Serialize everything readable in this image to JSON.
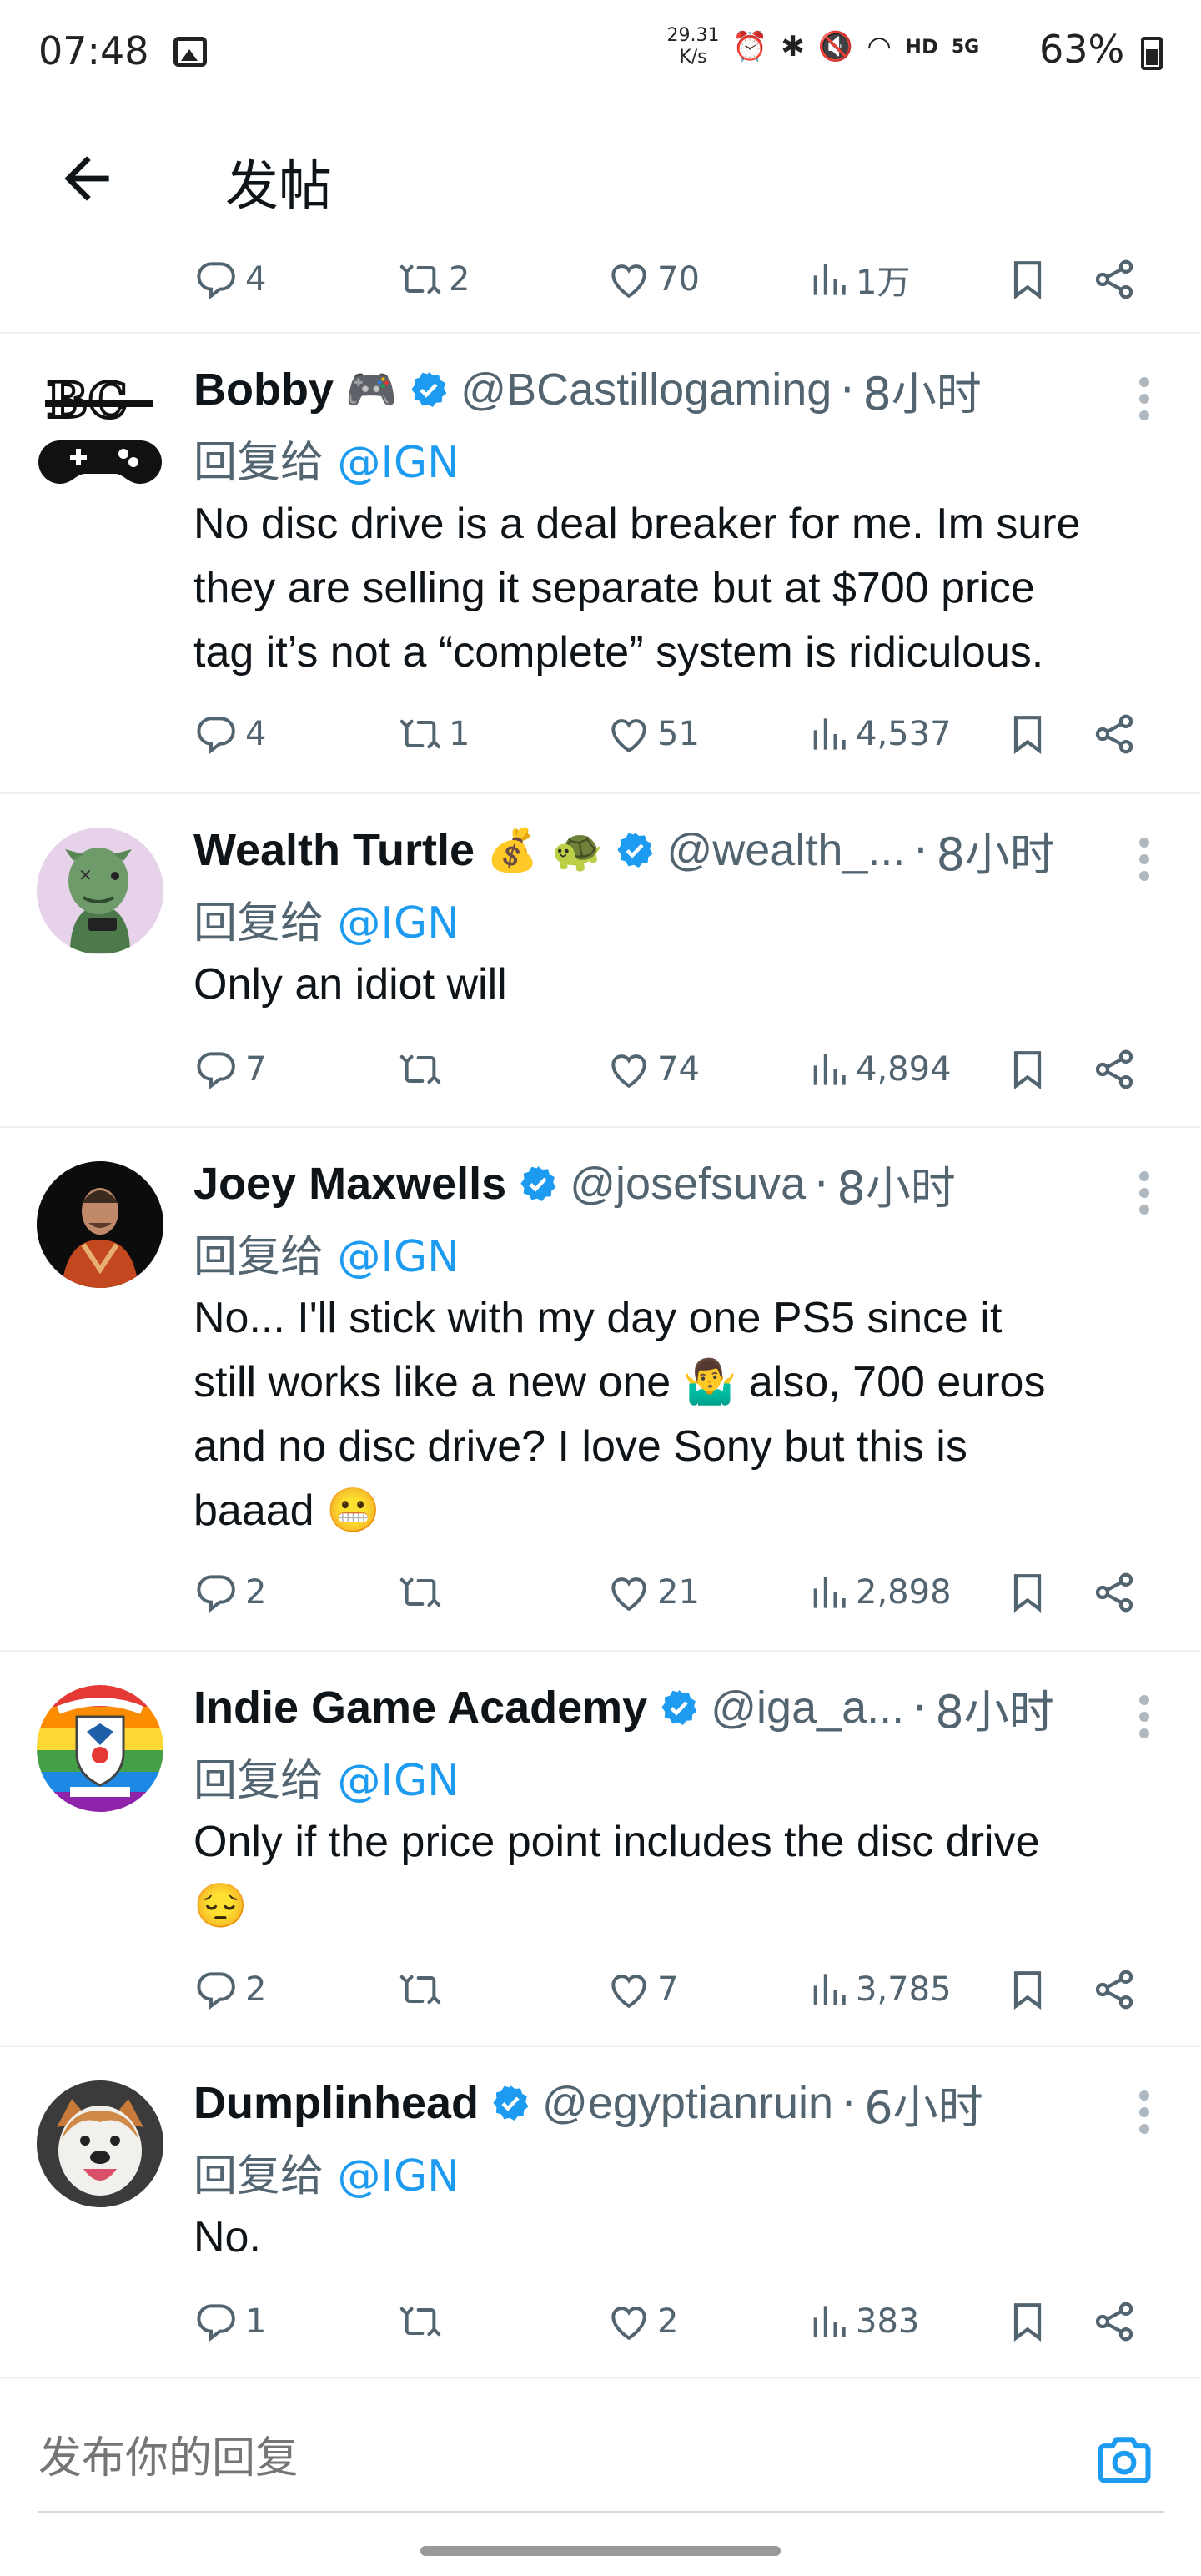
{
  "status_bar": {
    "time": "07:48",
    "speed_value": "29.31",
    "speed_unit": "K/s",
    "network": "HD",
    "signal": "5G",
    "battery": "63%"
  },
  "header": {
    "title": "发帖",
    "back_icon": "arrow-left-icon"
  },
  "top_actions": {
    "replies": "4",
    "reposts": "2",
    "likes": "70",
    "views": "1万"
  },
  "reply_prefix": "回复给",
  "reply_handle": "@IGN",
  "tweets": [
    {
      "name": "Bobby",
      "emoji": "🎮",
      "handle": "@BCastillogaming",
      "time": "8小时",
      "text_lines": [
        "No disc drive is a deal breaker for me. Im sure",
        "they are selling it separate but at $700 price",
        "tag it’s not a “complete” system is ridiculous."
      ],
      "replies": "4",
      "reposts": "1",
      "likes": "51",
      "views": "4,537"
    },
    {
      "name": "Wealth Turtle",
      "emoji": "💰 🐢",
      "handle": "@wealth_...",
      "time": "8小时",
      "text_lines": [
        "Only an idiot will"
      ],
      "replies": "7",
      "reposts": "",
      "likes": "74",
      "views": "4,894"
    },
    {
      "name": "Joey Maxwells",
      "emoji": "",
      "handle": "@josefsuva",
      "time": "8小时",
      "text_lines": [
        "No... I'll stick with my day one PS5 since it",
        "still works like a new one 🤷‍♂️  also, 700 euros",
        "and no disc drive? I love Sony but this is",
        "baaad 😬"
      ],
      "replies": "2",
      "reposts": "",
      "likes": "21",
      "views": "2,898"
    },
    {
      "name": "Indie Game Academy",
      "emoji": "",
      "handle": "@iga_a...",
      "time": "8小时",
      "text_lines": [
        "Only if the price point includes the disc drive",
        "😔"
      ],
      "replies": "2",
      "reposts": "",
      "likes": "7",
      "views": "3,785"
    },
    {
      "name": "Dumplinhead",
      "emoji": "",
      "handle": "@egyptianruin",
      "time": "6小时",
      "text_lines": [
        "No."
      ],
      "replies": "1",
      "reposts": "",
      "likes": "2",
      "views": "383"
    }
  ],
  "composer": {
    "placeholder": "发布你的回复",
    "camera_icon": "camera-icon"
  },
  "colors": {
    "accent": "#1d9bf0",
    "text": "#0f1419",
    "muted": "#536471",
    "divider": "#eff3f4"
  }
}
